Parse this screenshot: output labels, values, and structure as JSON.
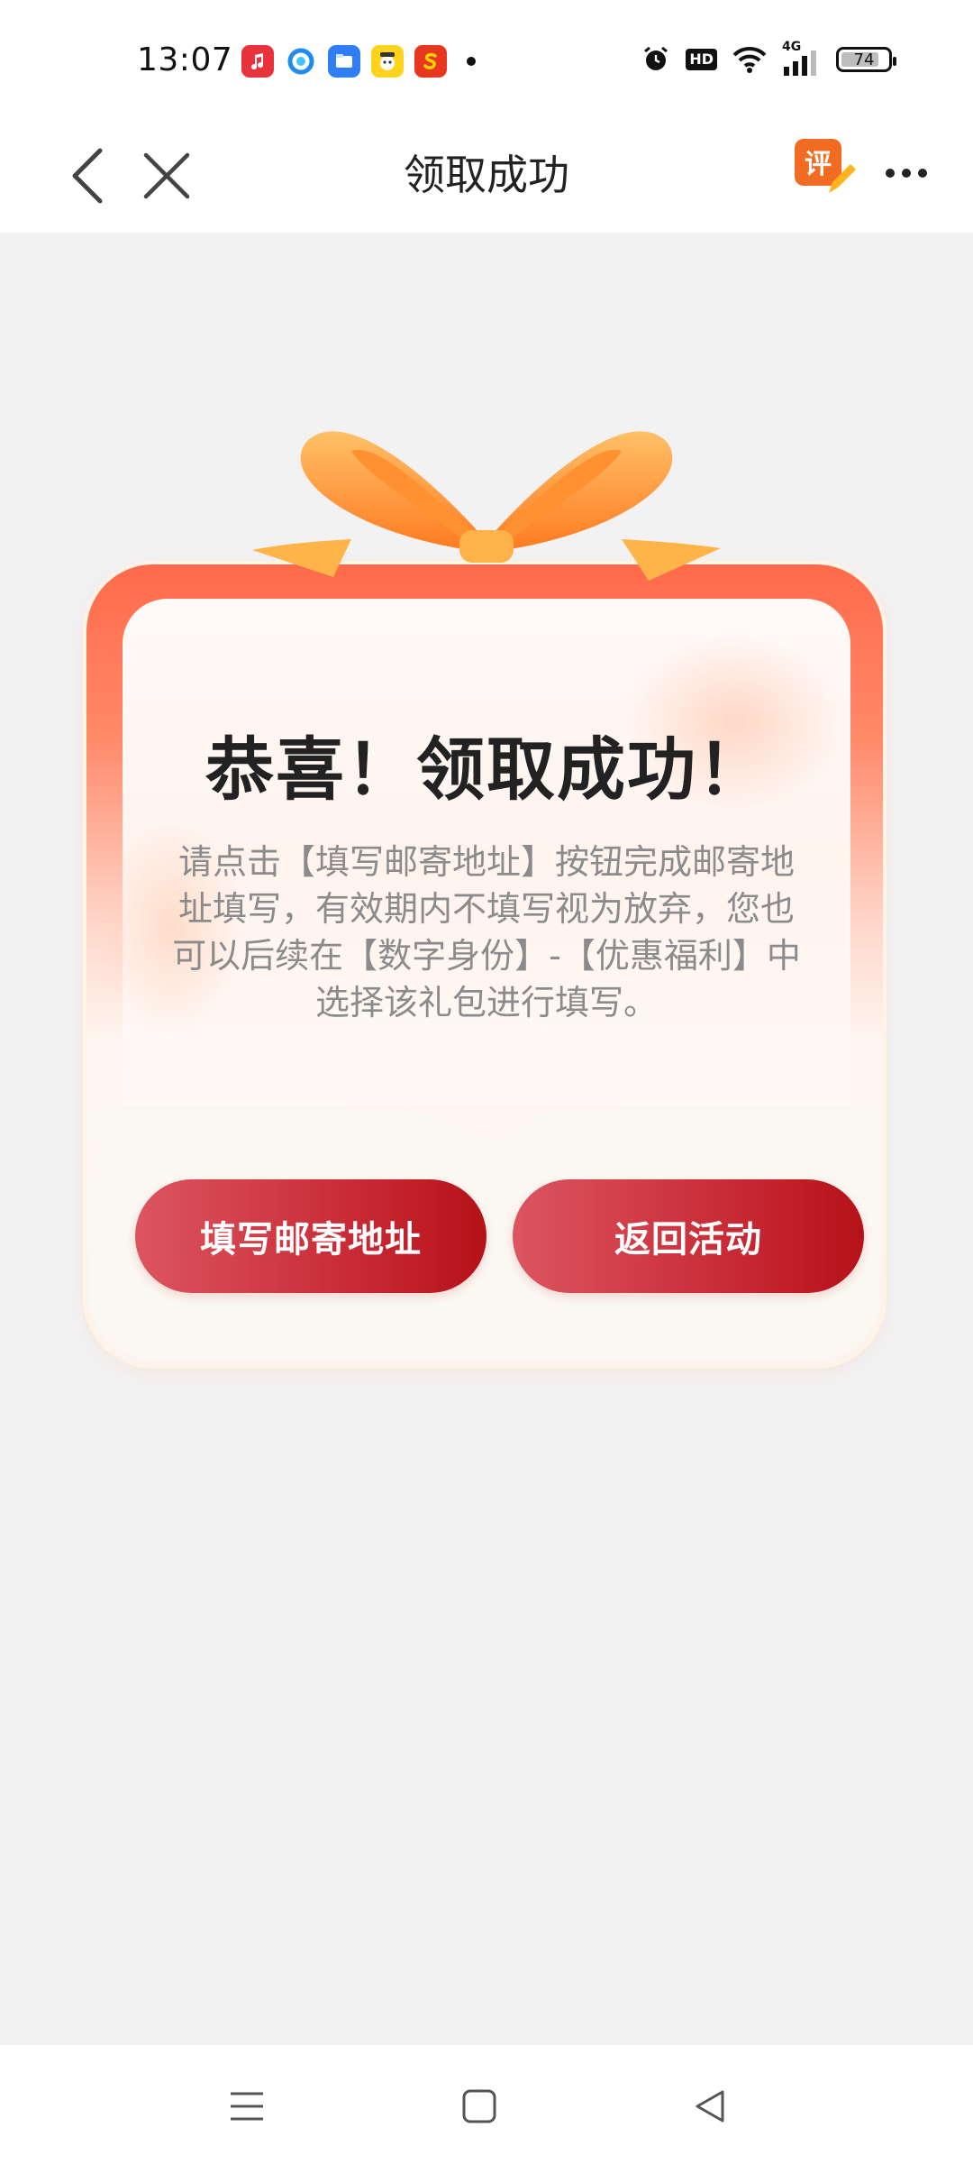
{
  "status_bar": {
    "time": "13:07",
    "app_icons": [
      "music-app-icon",
      "browser-app-icon",
      "files-app-icon",
      "game-app-icon",
      "shop-app-icon"
    ],
    "right_icons": [
      "alarm-icon",
      "hd-badge",
      "wifi-icon",
      "signal-4g-icon"
    ],
    "hd_label": "HD",
    "network_label": "4G",
    "battery": "74"
  },
  "navbar": {
    "title": "领取成功",
    "review_label": "评"
  },
  "card": {
    "title": "恭喜！领取成功！",
    "description": "请点击【填写邮寄地址】按钮完成邮寄地址填写，有效期内不填写视为放弃，您也可以后续在【数字身份】-【优惠福利】中选择该礼包进行填写。",
    "buttons": {
      "fill_address": "填写邮寄地址",
      "return": "返回活动"
    }
  },
  "colors": {
    "accent_red": "#c52530",
    "card_top": "#ff6a4a",
    "ribbon_orange": "#ff9e3d"
  }
}
